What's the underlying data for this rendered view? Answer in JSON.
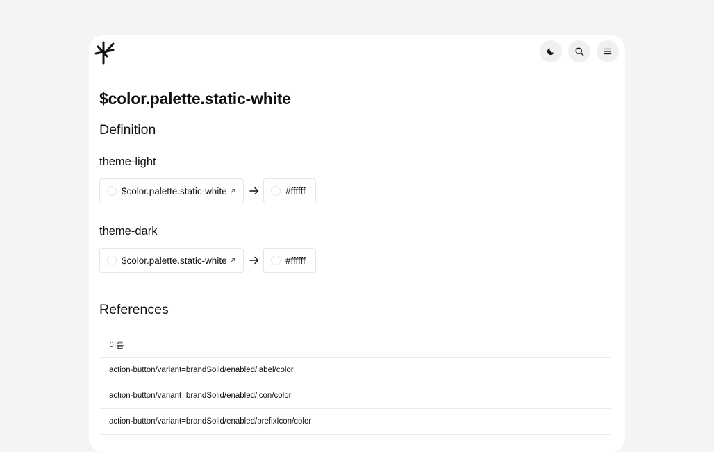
{
  "header": {
    "logo_icon": "brand-logo-icon",
    "theme_toggle_icon": "moon-icon",
    "search_icon": "search-icon",
    "menu_icon": "menu-icon"
  },
  "page": {
    "title": "$color.palette.static-white"
  },
  "definition": {
    "heading": "Definition",
    "themes": [
      {
        "name": "theme-light",
        "token": "$color.palette.static-white",
        "value": "#ffffff"
      },
      {
        "name": "theme-dark",
        "token": "$color.palette.static-white",
        "value": "#ffffff"
      }
    ]
  },
  "references": {
    "heading": "References",
    "column_header": "이름",
    "rows": [
      "action-button/variant=brandSolid/enabled/label/color",
      "action-button/variant=brandSolid/enabled/icon/color",
      "action-button/variant=brandSolid/enabled/prefixIcon/color"
    ]
  },
  "colors": {
    "page_background": "#f3f4f6",
    "card_background": "#ffffff",
    "button_background": "#f0f0f1",
    "swatch": "#ffffff"
  }
}
